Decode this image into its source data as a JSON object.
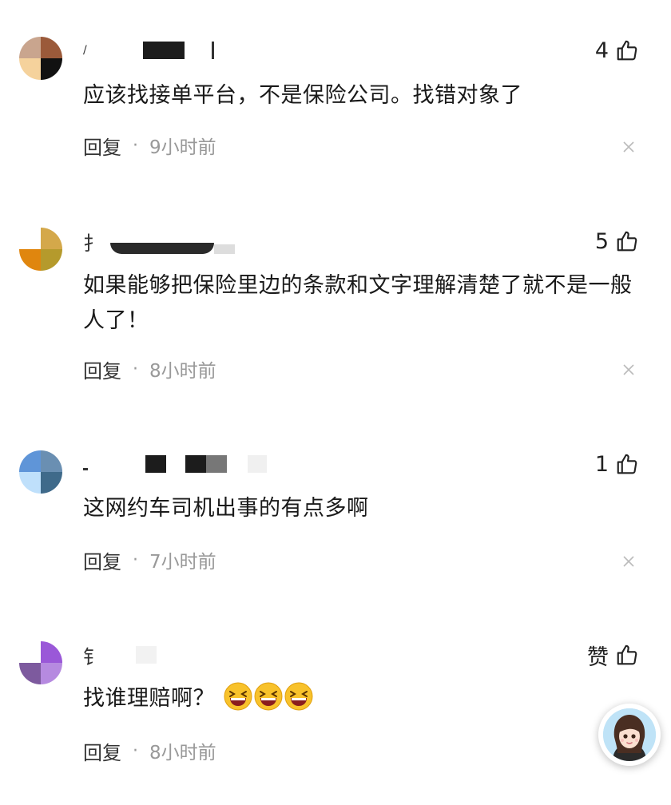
{
  "comments": [
    {
      "name_initial": " ",
      "like_count": "4",
      "text": "应该找接单平台，不是保险公司。找错对象了",
      "reply_label": "回复",
      "separator": "·",
      "time": "9小时前",
      "avatar_colors": [
        "#c9a58e",
        "#9b5a3a",
        "#f5d29c",
        "#111111"
      ]
    },
    {
      "name_initial": "扌",
      "like_count": "5",
      "text": "如果能够把保险里边的条款和文字理解清楚了就不是一般人了！",
      "reply_label": "回复",
      "separator": "·",
      "time": "8小时前",
      "avatar_colors": [
        "#ffffff",
        "#d4a84a",
        "#e0860e",
        "#b59a2c"
      ]
    },
    {
      "name_initial": "",
      "like_count": "1",
      "text": "这网约车司机出事的有点多啊",
      "reply_label": "回复",
      "separator": "·",
      "time": "7小时前",
      "avatar_colors": [
        "#5f95d8",
        "#6a8fb2",
        "#bfe0fb",
        "#3f6a8a"
      ]
    },
    {
      "name_initial": "钅",
      "like_count": "赞",
      "text": "找谁理赔啊？",
      "reply_label": "回复",
      "separator": "·",
      "time": "8小时前",
      "avatar_colors": [
        "#ffffff",
        "#9a58d8",
        "#7d5a9e",
        "#b68ae0"
      ]
    }
  ],
  "icons": {
    "like": "thumbs-up-icon",
    "close": "close-icon",
    "emoji": "laughing-emoji-icon",
    "assistant": "assistant-avatar-icon"
  }
}
